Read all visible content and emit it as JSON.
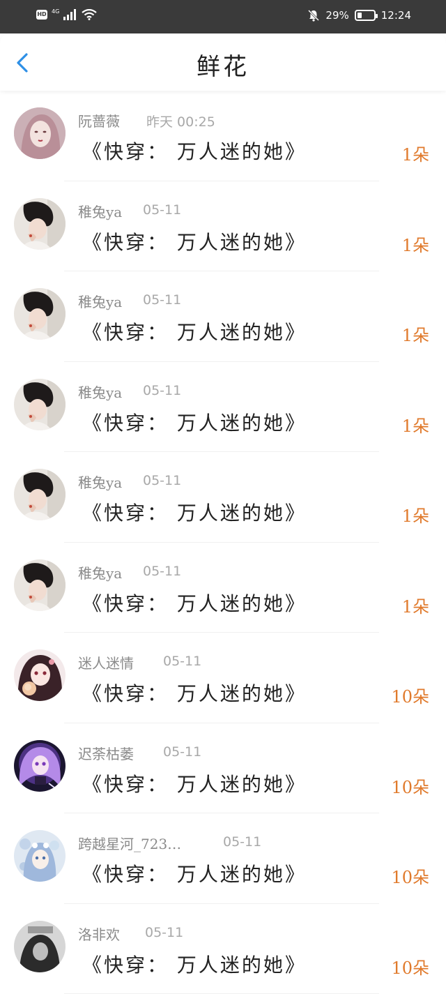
{
  "status_bar": {
    "hd": "HD",
    "network": "4G",
    "battery_percent": "29%",
    "battery_level": 0.29,
    "time": "12:24"
  },
  "header": {
    "title": "鲜花",
    "back_icon": "chevron-left-icon"
  },
  "colors": {
    "accent": "#2e8fe6",
    "count": "#e07a2c",
    "status_bar_bg": "#3a3a3a"
  },
  "rows": [
    {
      "name": "阮蔷薇",
      "date": "昨天 00:25",
      "book": "《快穿： 万人迷的她》",
      "count": "1朵",
      "avatar": "pale-girl"
    },
    {
      "name": "稚兔ya",
      "date": "05-11",
      "book": "《快穿： 万人迷的她》",
      "count": "1朵",
      "avatar": "dark-hair-girl"
    },
    {
      "name": "稚兔ya",
      "date": "05-11",
      "book": "《快穿： 万人迷的她》",
      "count": "1朵",
      "avatar": "dark-hair-girl"
    },
    {
      "name": "稚兔ya",
      "date": "05-11",
      "book": "《快穿： 万人迷的她》",
      "count": "1朵",
      "avatar": "dark-hair-girl"
    },
    {
      "name": "稚兔ya",
      "date": "05-11",
      "book": "《快穿： 万人迷的她》",
      "count": "1朵",
      "avatar": "dark-hair-girl"
    },
    {
      "name": "稚兔ya",
      "date": "05-11",
      "book": "《快穿： 万人迷的她》",
      "count": "1朵",
      "avatar": "dark-hair-girl"
    },
    {
      "name": "迷人迷情",
      "date": "05-11",
      "book": "《快穿： 万人迷的她》",
      "count": "10朵",
      "avatar": "anime-girl-pink"
    },
    {
      "name": "迟荼枯萎",
      "date": "05-11",
      "book": "《快穿： 万人迷的她》",
      "count": "10朵",
      "avatar": "anime-girl-purple"
    },
    {
      "name": "跨越星河_723…",
      "date": "05-11",
      "book": "《快穿： 万人迷的她》",
      "count": "10朵",
      "avatar": "anime-girl-blue"
    },
    {
      "name": "洛非欢",
      "date": "05-11",
      "book": "《快穿： 万人迷的她》",
      "count": "10朵",
      "avatar": "mono-photo"
    }
  ]
}
